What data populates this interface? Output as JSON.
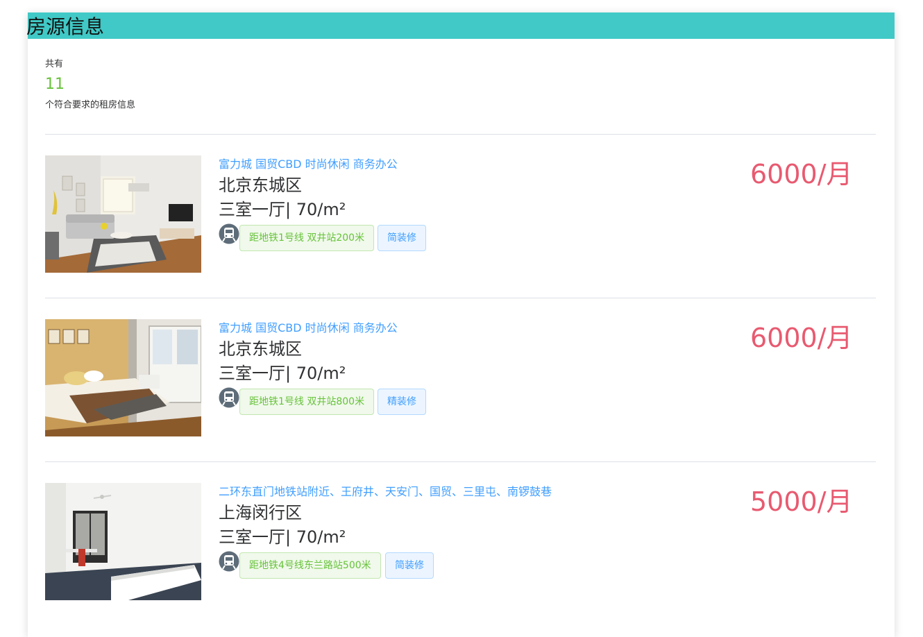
{
  "header": {
    "title": "房源信息"
  },
  "summary": {
    "prefix": "共有",
    "count": "11",
    "suffix": "个符合要求的租房信息"
  },
  "listings": [
    {
      "tags": "富力城 国贸CBD 时尚休闲 商务办公",
      "district": "北京东城区",
      "layout": "三室一厅| 70/m²",
      "metro": "距地铁1号线 双井站200米",
      "decoration": "简装修",
      "price": "6000/月",
      "photo": "living-room-photo"
    },
    {
      "tags": "富力城 国贸CBD 时尚休闲 商务办公",
      "district": "北京东城区",
      "layout": "三室一厅| 70/m²",
      "metro": "距地铁1号线 双井站800米",
      "decoration": "精装修",
      "price": "6000/月",
      "photo": "bedroom-photo"
    },
    {
      "tags": "二环东直门地铁站附近、王府井、天安门、国贸、三里屯、南锣鼓巷",
      "district": "上海闵行区",
      "layout": "三室一厅| 70/m²",
      "metro": "距地铁4号线东兰路站500米",
      "decoration": "简装修",
      "price": "5000/月",
      "photo": "white-room-photo"
    }
  ],
  "colors": {
    "header_bg": "#40c9c6",
    "price": "#e85a70",
    "tag_link": "#409eff",
    "count": "#67c23a"
  },
  "icons": {
    "metro": "subway-train-icon"
  }
}
